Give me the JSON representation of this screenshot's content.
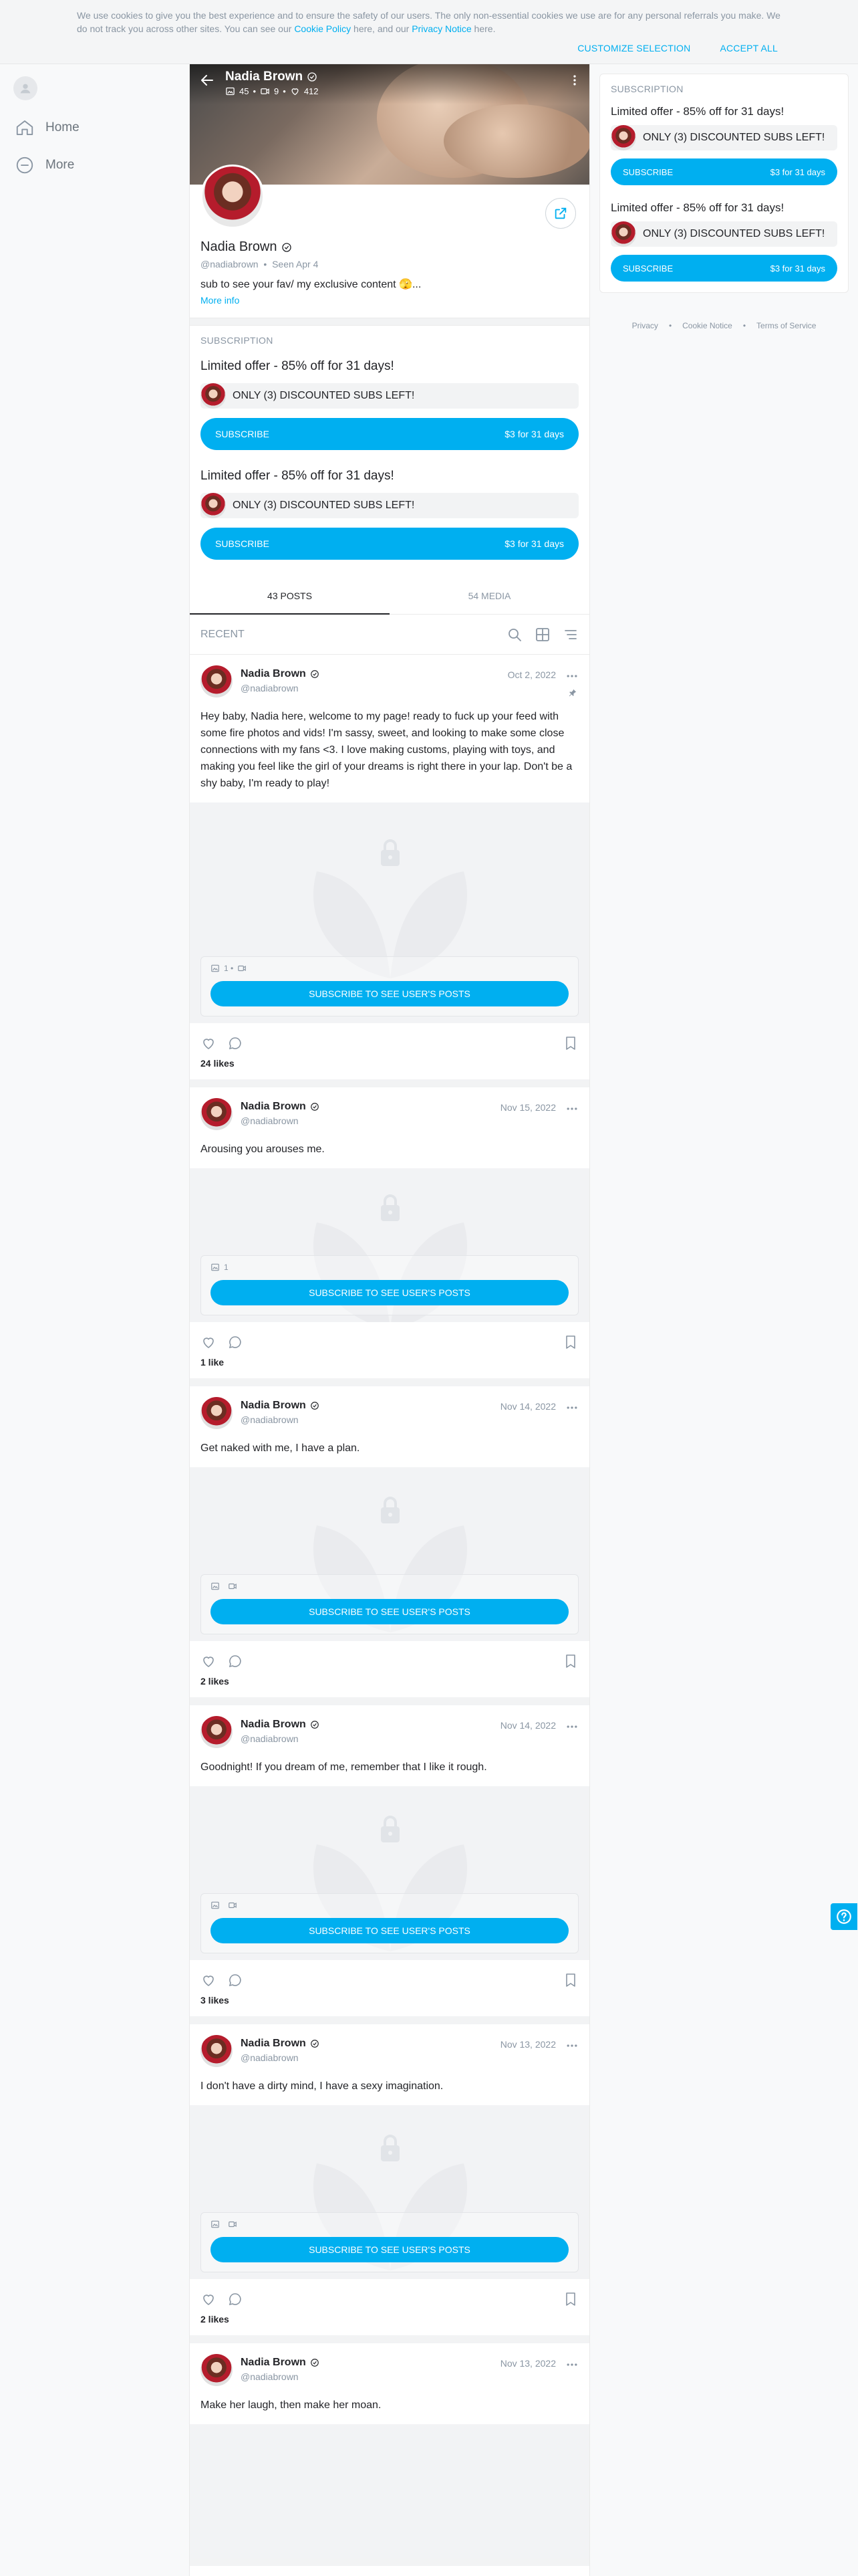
{
  "cookie": {
    "text_1": "We use cookies to give you the best experience and to ensure the safety of our users. The only non-essential cookies we use are for any personal referrals you make. We do not track you across other sites. You can see our ",
    "cookie_policy": "Cookie Policy",
    "text_2": " here, and our ",
    "privacy_notice": "Privacy Notice",
    "text_3": " here.",
    "customize": "Customize selection",
    "accept": "Accept all"
  },
  "nav": {
    "home": "Home",
    "more": "More"
  },
  "profile": {
    "name": "Nadia Brown",
    "stats_photos": "45",
    "stats_videos": "9",
    "stats_likes": "412",
    "handle": "@nadiabrown",
    "seen": "Seen  Apr 4",
    "bio": "sub to see your fav/ my exclusive content 🫣...",
    "more_info": "More info"
  },
  "subscription": {
    "label": "Subscription",
    "offers": [
      {
        "title": "Limited offer - 85% off for 31 days!",
        "subs_left": "ONLY (3) DISCOUNTED SUBS LEFT!",
        "button": "SUBSCRIBE",
        "price": "$3 for 31 days"
      },
      {
        "title": "Limited offer - 85% off for 31 days!",
        "subs_left": "ONLY (3) DISCOUNTED SUBS LEFT!",
        "button": "SUBSCRIBE",
        "price": "$3 for 31 days"
      }
    ]
  },
  "tabs": {
    "posts": "43 Posts",
    "media": "54 Media"
  },
  "recent_label": "Recent",
  "lock_button": "Subscribe to see user's posts",
  "posts": [
    {
      "name": "Nadia Brown",
      "handle": "@nadiabrown",
      "date": "Oct 2, 2022",
      "text": "Hey baby, Nadia here, welcome to my page! ready to fuck up your feed with some fire photos and vids! I'm sassy, sweet, and looking to make some close connections with my fans <3. I love making customs, playing with toys, and making you feel like the girl of your dreams is right there in your lap. Don't be a shy baby, I'm ready to play!",
      "media": "1 • ",
      "likes": "24 likes"
    },
    {
      "name": "Nadia Brown",
      "handle": "@nadiabrown",
      "date": "Nov 15, 2022",
      "text": "Arousing you arouses me.",
      "media": "1",
      "likes": "1 like"
    },
    {
      "name": "Nadia Brown",
      "handle": "@nadiabrown",
      "date": "Nov 14, 2022",
      "text": "Get naked with me, I have a plan.",
      "media": "",
      "likes": "2 likes"
    },
    {
      "name": "Nadia Brown",
      "handle": "@nadiabrown",
      "date": "Nov 14, 2022",
      "text": "Goodnight! If you dream of me, remember that I like it rough.",
      "media": "",
      "likes": "3 likes"
    },
    {
      "name": "Nadia Brown",
      "handle": "@nadiabrown",
      "date": "Nov 13, 2022",
      "text": "I don't have a dirty mind, I have a sexy imagination.",
      "media": "",
      "likes": "2 likes"
    },
    {
      "name": "Nadia Brown",
      "handle": "@nadiabrown",
      "date": "Nov 13, 2022",
      "text": "Make her laugh, then make her moan.",
      "media": "",
      "likes": ""
    }
  ],
  "footer": {
    "privacy": "Privacy",
    "cookie": "Cookie Notice",
    "terms": "Terms of Service"
  },
  "colors": {
    "accent": "#00aff0",
    "muted": "#8a96a3",
    "text": "#242529"
  }
}
